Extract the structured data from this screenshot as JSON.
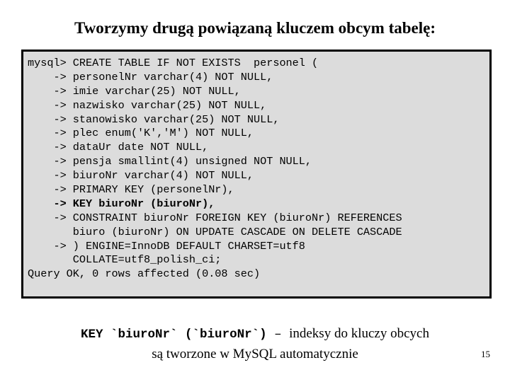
{
  "slide": {
    "title": "Tworzymy drugą powiązaną kluczem obcym tabelę:",
    "page_number": "15"
  },
  "console": {
    "background_color": "#dcdcdc",
    "border_color": "#000000",
    "lines": [
      {
        "text": "mysql> CREATE TABLE IF NOT EXISTS  personel (",
        "bold": false
      },
      {
        "text": "    -> personelNr varchar(4) NOT NULL,",
        "bold": false
      },
      {
        "text": "    -> imie varchar(25) NOT NULL,",
        "bold": false
      },
      {
        "text": "    -> nazwisko varchar(25) NOT NULL,",
        "bold": false
      },
      {
        "text": "    -> stanowisko varchar(25) NOT NULL,",
        "bold": false
      },
      {
        "text": "    -> plec enum('K','M') NOT NULL,",
        "bold": false
      },
      {
        "text": "    -> dataUr date NOT NULL,",
        "bold": false
      },
      {
        "text": "    -> pensja smallint(4) unsigned NOT NULL,",
        "bold": false
      },
      {
        "text": "    -> biuroNr varchar(4) NOT NULL,",
        "bold": false
      },
      {
        "text": "    -> PRIMARY KEY (personelNr),",
        "bold": false
      },
      {
        "text": "    -> KEY biuroNr (biuroNr),",
        "bold": true
      },
      {
        "text": "    -> CONSTRAINT biuroNr FOREIGN KEY (biuroNr) REFERENCES",
        "bold": false
      },
      {
        "text": "       biuro (biuroNr) ON UPDATE CASCADE ON DELETE CASCADE",
        "bold": false
      },
      {
        "text": "    -> ) ENGINE=InnoDB DEFAULT CHARSET=utf8",
        "bold": false
      },
      {
        "text": "       COLLATE=utf8_polish_ci;",
        "bold": false
      },
      {
        "text": "Query OK, 0 rows affected (0.08 sec)",
        "bold": false
      }
    ]
  },
  "caption": {
    "code_part": "KEY `biuroNr` (`biuroNr`)",
    "dash": " – ",
    "text_part": "indeksy do kluczy obcych",
    "line2": "są tworzone w MySQL automatycznie"
  }
}
